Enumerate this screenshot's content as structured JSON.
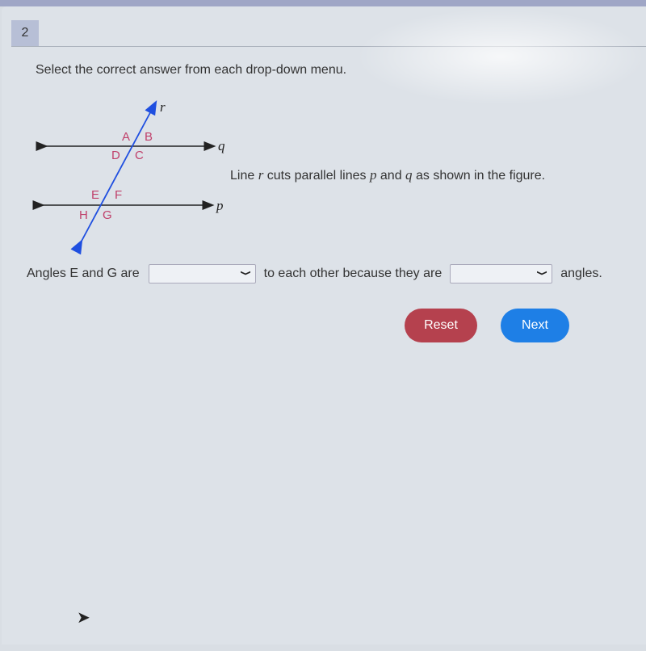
{
  "question": {
    "number": "2",
    "instruction": "Select the correct answer from each drop-down menu."
  },
  "figure": {
    "lines": {
      "transversal": "r",
      "upper": "q",
      "lower": "p"
    },
    "angles_upper": [
      "A",
      "B",
      "D",
      "C"
    ],
    "angles_lower": [
      "E",
      "F",
      "H",
      "G"
    ],
    "line_color": "#222222",
    "transversal_color": "#1f4fe0",
    "label_color": "#c0406a"
  },
  "description": {
    "pre": "Line ",
    "r": "r",
    "mid1": " cuts parallel lines ",
    "p": "p",
    "mid2": " and ",
    "q": "q",
    "post": " as shown in the figure."
  },
  "sentence": {
    "part1": "Angles E and G are",
    "dropdown1_value": "",
    "part2": "to each other because they are",
    "dropdown2_value": "",
    "part3": "angles."
  },
  "buttons": {
    "reset": "Reset",
    "next": "Next"
  },
  "colors": {
    "reset": "#b5414e",
    "next": "#1e7fe6"
  }
}
